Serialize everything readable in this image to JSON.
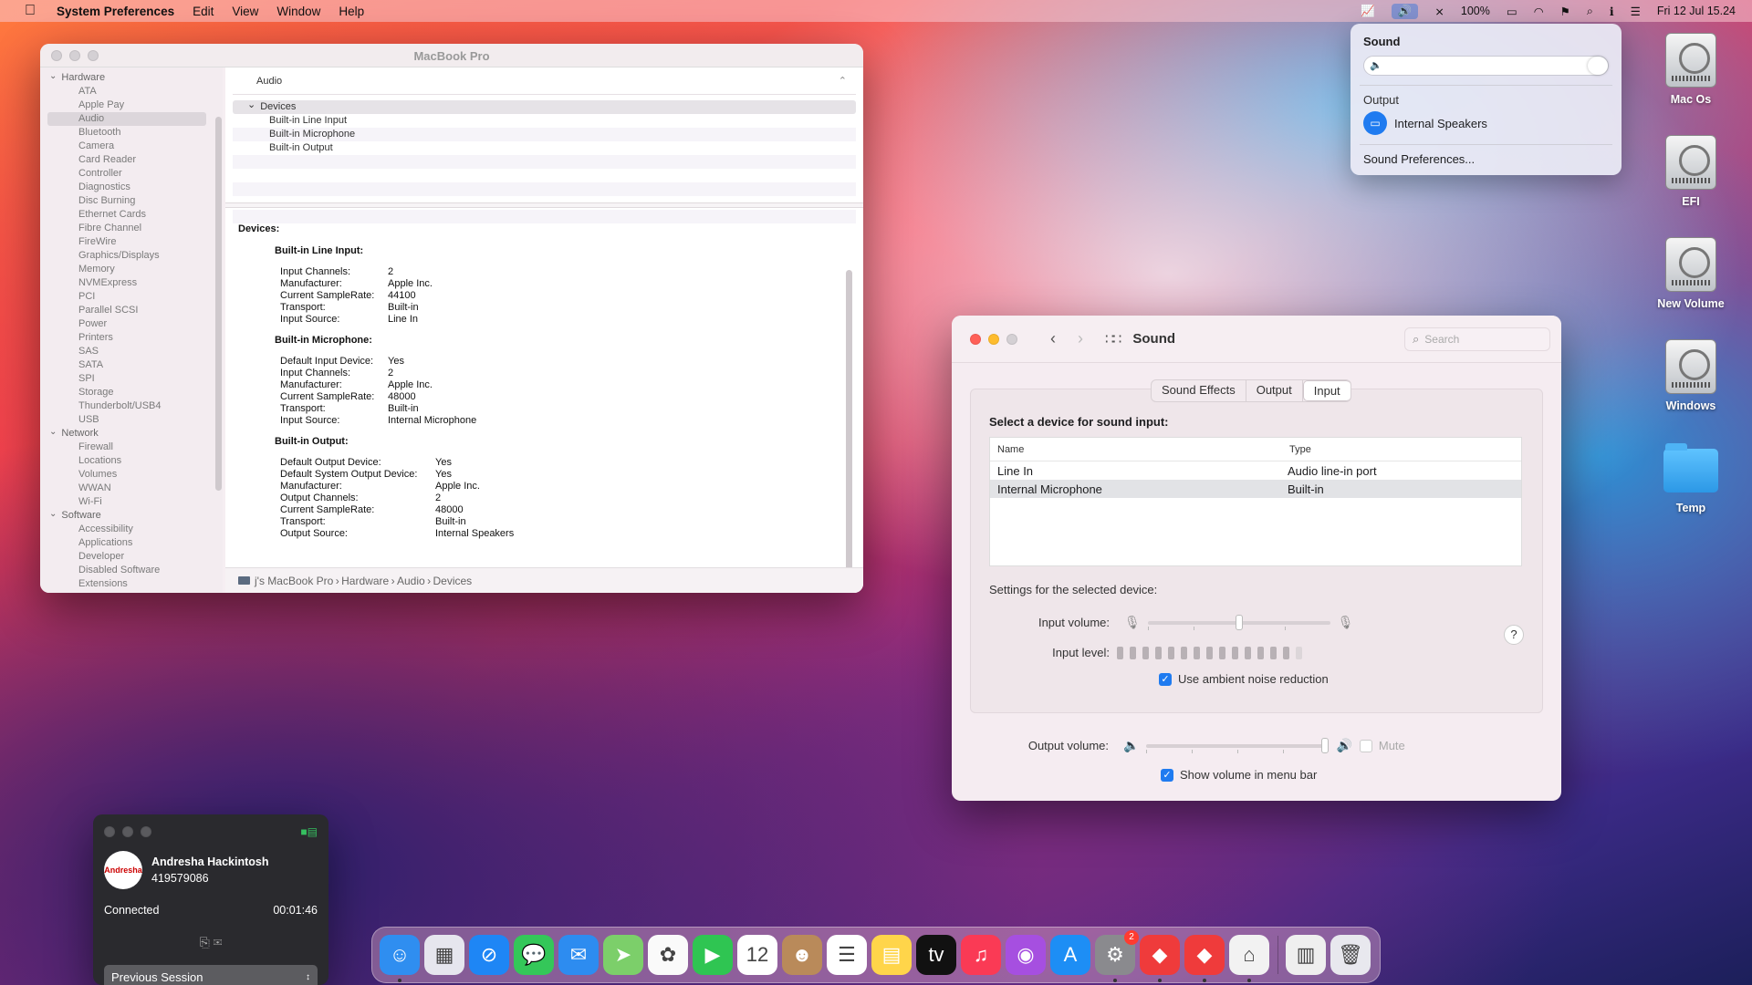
{
  "menubar": {
    "apple_icon": "apple-icon",
    "app_name": "System Preferences",
    "menus": [
      "Edit",
      "View",
      "Window",
      "Help"
    ],
    "battery": "100%",
    "datetime": "Fri 12 Jul  15.24"
  },
  "sysinfo": {
    "title": "MacBook Pro",
    "sidebar": {
      "groups": [
        {
          "label": "Hardware",
          "items": [
            "ATA",
            "Apple Pay",
            "Audio",
            "Bluetooth",
            "Camera",
            "Card Reader",
            "Controller",
            "Diagnostics",
            "Disc Burning",
            "Ethernet Cards",
            "Fibre Channel",
            "FireWire",
            "Graphics/Displays",
            "Memory",
            "NVMExpress",
            "PCI",
            "Parallel SCSI",
            "Power",
            "Printers",
            "SAS",
            "SATA",
            "SPI",
            "Storage",
            "Thunderbolt/USB4",
            "USB"
          ]
        },
        {
          "label": "Network",
          "items": [
            "Firewall",
            "Locations",
            "Volumes",
            "WWAN",
            "Wi-Fi"
          ]
        },
        {
          "label": "Software",
          "items": [
            "Accessibility",
            "Applications",
            "Developer",
            "Disabled Software",
            "Extensions"
          ]
        }
      ],
      "selected": "Audio"
    },
    "section_header": "Audio",
    "tree": {
      "group": "Devices",
      "items": [
        "Built-in Line Input",
        "Built-in Microphone",
        "Built-in Output"
      ]
    },
    "detail": {
      "heading": "Devices:",
      "blocks": [
        {
          "title": "Built-in Line Input:",
          "rows": [
            [
              "Input Channels:",
              "2"
            ],
            [
              "Manufacturer:",
              "Apple Inc."
            ],
            [
              "Current SampleRate:",
              "44100"
            ],
            [
              "Transport:",
              "Built-in"
            ],
            [
              "Input Source:",
              "Line In"
            ]
          ]
        },
        {
          "title": "Built-in Microphone:",
          "rows": [
            [
              "Default Input Device:",
              "Yes"
            ],
            [
              "Input Channels:",
              "2"
            ],
            [
              "Manufacturer:",
              "Apple Inc."
            ],
            [
              "Current SampleRate:",
              "48000"
            ],
            [
              "Transport:",
              "Built-in"
            ],
            [
              "Input Source:",
              "Internal Microphone"
            ]
          ]
        },
        {
          "title": "Built-in Output:",
          "rows": [
            [
              "Default Output Device:",
              "Yes"
            ],
            [
              "Default System Output Device:",
              "Yes"
            ],
            [
              "Manufacturer:",
              "Apple Inc."
            ],
            [
              "Output Channels:",
              "2"
            ],
            [
              "Current SampleRate:",
              "48000"
            ],
            [
              "Transport:",
              "Built-in"
            ],
            [
              "Output Source:",
              "Internal Speakers"
            ]
          ]
        }
      ]
    },
    "pathbar": [
      "j's MacBook Pro",
      "Hardware",
      "Audio",
      "Devices"
    ]
  },
  "soundmenu": {
    "heading": "Sound",
    "volume_fraction": 1.0,
    "output_label": "Output",
    "output_device": "Internal Speakers",
    "prefs_link": "Sound Preferences..."
  },
  "desktop_icons": [
    {
      "label": "Mac Os",
      "kind": "drive"
    },
    {
      "label": "EFI",
      "kind": "drive"
    },
    {
      "label": "New Volume",
      "kind": "drive"
    },
    {
      "label": "Windows",
      "kind": "drive"
    },
    {
      "label": "Temp",
      "kind": "folder"
    }
  ],
  "soundprefs": {
    "title": "Sound",
    "search_placeholder": "Search",
    "tabs": [
      "Sound Effects",
      "Output",
      "Input"
    ],
    "active_tab": "Input",
    "select_label": "Select a device for sound input:",
    "columns": [
      "Name",
      "Type"
    ],
    "devices": [
      {
        "name": "Line In",
        "type": "Audio line-in port",
        "selected": false
      },
      {
        "name": "Internal Microphone",
        "type": "Built-in",
        "selected": true
      }
    ],
    "settings_label": "Settings for the selected device:",
    "input_volume_label": "Input volume:",
    "input_volume_fraction": 0.5,
    "input_level_label": "Input level:",
    "input_level_bars_total": 15,
    "input_level_bars_active": 14,
    "ambient_label": "Use ambient noise reduction",
    "ambient_checked": true,
    "help_text": "?",
    "output_volume_label": "Output volume:",
    "output_volume_fraction": 1.0,
    "mute_label": "Mute",
    "mute_checked": false,
    "show_volume_label": "Show volume in menu bar",
    "show_volume_checked": true
  },
  "remote": {
    "user_name": "Andresha Hackintosh",
    "user_id": "419579086",
    "avatar_text": "Andresha",
    "status": "Connected",
    "duration": "00:01:46",
    "session_select": "Previous Session"
  },
  "dock": {
    "apps": [
      {
        "name": "finder-icon",
        "color": "#2f8ef0",
        "glyph": "☺",
        "running": true
      },
      {
        "name": "launchpad-icon",
        "color": "#e6e6ee",
        "glyph": "▦",
        "running": false
      },
      {
        "name": "safari-icon",
        "color": "#1e86f5",
        "glyph": "⊘",
        "running": false
      },
      {
        "name": "messages-icon",
        "color": "#34c759",
        "glyph": "💬",
        "running": false
      },
      {
        "name": "mail-icon",
        "color": "#2d8cf0",
        "glyph": "✉",
        "running": false
      },
      {
        "name": "maps-icon",
        "color": "#7ccf6a",
        "glyph": "➤",
        "running": false
      },
      {
        "name": "photos-icon",
        "color": "#fafafa",
        "glyph": "✿",
        "running": false
      },
      {
        "name": "facetime-icon",
        "color": "#2fc552",
        "glyph": "▶",
        "running": false
      },
      {
        "name": "calendar-icon",
        "color": "#ffffff",
        "glyph": "12",
        "running": false
      },
      {
        "name": "contacts-icon",
        "color": "#b98a5a",
        "glyph": "☻",
        "running": false
      },
      {
        "name": "reminders-icon",
        "color": "#ffffff",
        "glyph": "☰",
        "running": false
      },
      {
        "name": "notes-icon",
        "color": "#ffd54a",
        "glyph": "▤",
        "running": false
      },
      {
        "name": "appletv-icon",
        "color": "#111111",
        "glyph": "tv",
        "running": false
      },
      {
        "name": "music-icon",
        "color": "#fa3a55",
        "glyph": "♫",
        "running": false
      },
      {
        "name": "podcasts-icon",
        "color": "#a64fe0",
        "glyph": "◉",
        "running": false
      },
      {
        "name": "appstore-icon",
        "color": "#1d8ef5",
        "glyph": "A",
        "running": false
      },
      {
        "name": "system-preferences-icon",
        "color": "#8a8a8e",
        "glyph": "⚙",
        "running": true,
        "badge": "2"
      },
      {
        "name": "anydesk-icon",
        "color": "#ef3b3b",
        "glyph": "◆",
        "running": true
      },
      {
        "name": "anydesk-2-icon",
        "color": "#ef3b3b",
        "glyph": "◆",
        "running": true
      },
      {
        "name": "system-information-icon",
        "color": "#f2f2f2",
        "glyph": "⌂",
        "running": true
      },
      {
        "name": "archive-icon",
        "color": "#efefef",
        "glyph": "▥",
        "running": false
      },
      {
        "name": "trash-icon",
        "color": "#e8e8ee",
        "glyph": "🗑",
        "running": false
      }
    ]
  }
}
